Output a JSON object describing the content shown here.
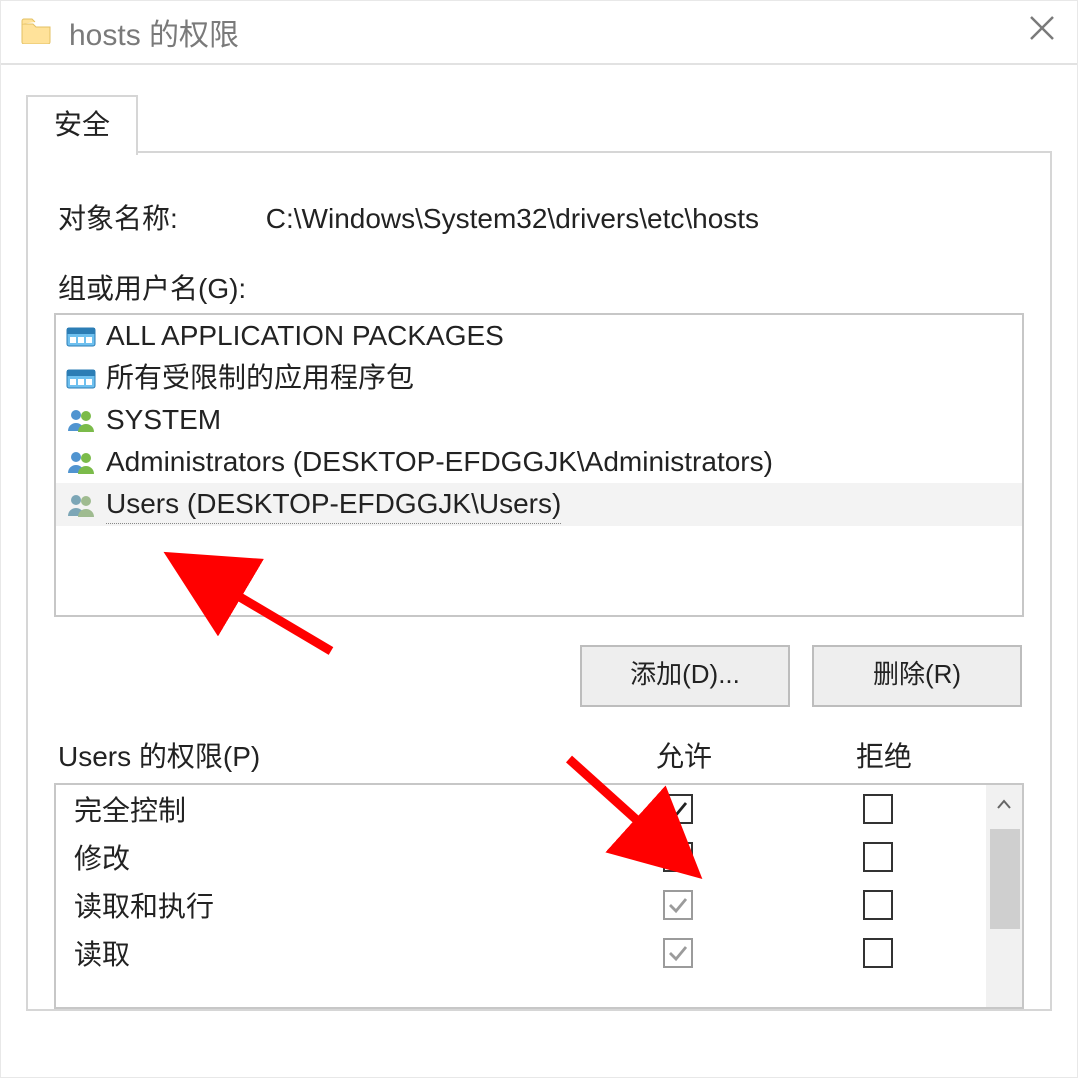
{
  "titlebar": {
    "title": "hosts 的权限"
  },
  "tab": {
    "label": "安全"
  },
  "object": {
    "label": "对象名称:",
    "path": "C:\\Windows\\System32\\drivers\\etc\\hosts"
  },
  "groups": {
    "label": "组或用户名(G):",
    "items": [
      {
        "icon": "package",
        "text": "ALL APPLICATION PACKAGES"
      },
      {
        "icon": "package",
        "text": "所有受限制的应用程序包"
      },
      {
        "icon": "users",
        "text": "SYSTEM"
      },
      {
        "icon": "users",
        "text": "Administrators (DESKTOP-EFDGGJK\\Administrators)"
      },
      {
        "icon": "users",
        "text": "Users (DESKTOP-EFDGGJK\\Users)"
      }
    ],
    "selected_index": 4
  },
  "buttons": {
    "add": "添加(D)...",
    "remove": "删除(R)"
  },
  "permissions": {
    "title": "Users 的权限(P)",
    "headers": {
      "allow": "允许",
      "deny": "拒绝"
    },
    "rows": [
      {
        "name": "完全控制",
        "allow": "checked",
        "deny": "empty"
      },
      {
        "name": "修改",
        "allow": "checked",
        "deny": "empty"
      },
      {
        "name": "读取和执行",
        "allow": "dim",
        "deny": "empty"
      },
      {
        "name": "读取",
        "allow": "dim",
        "deny": "empty"
      }
    ]
  }
}
